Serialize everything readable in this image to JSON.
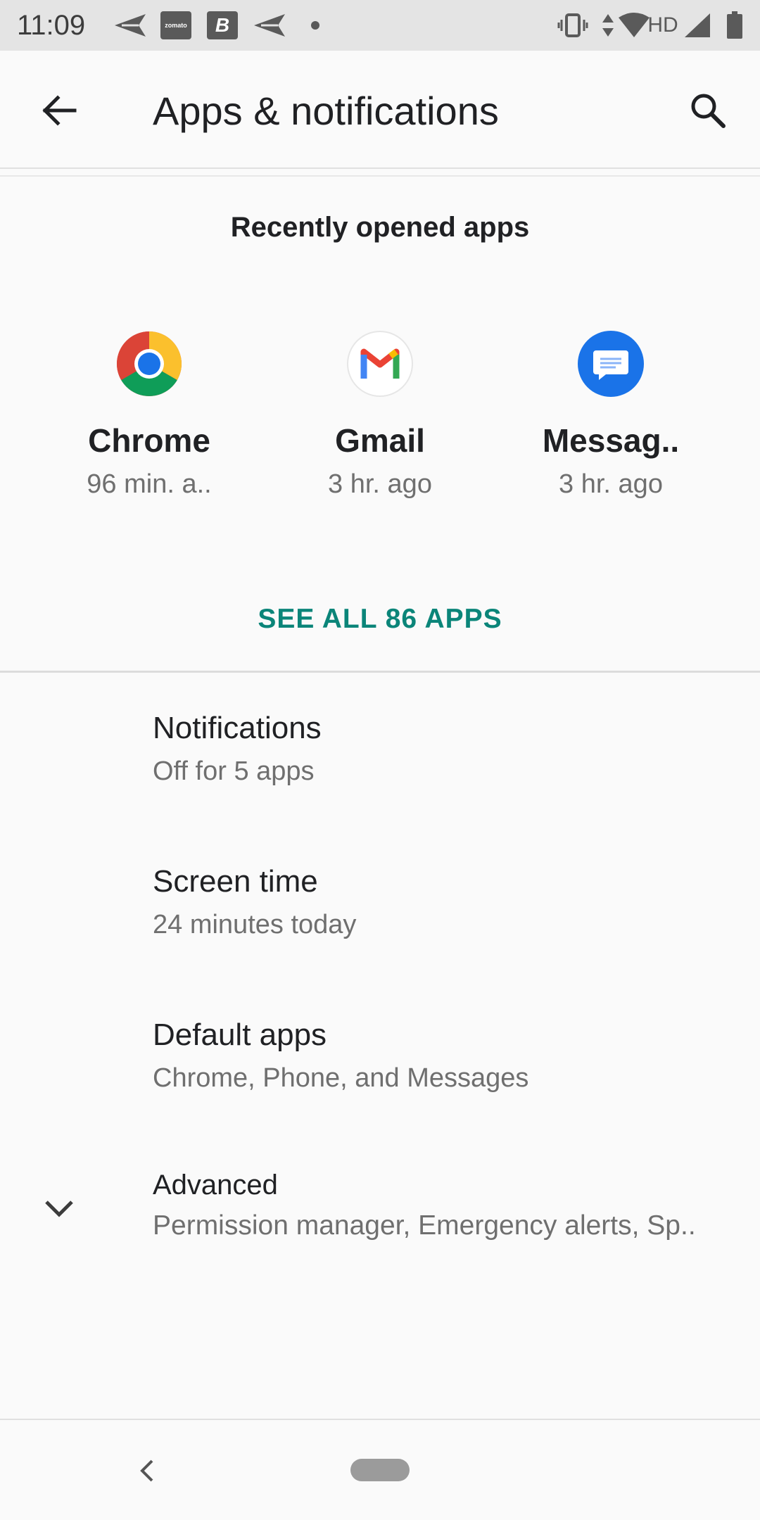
{
  "status_bar": {
    "time": "11:09",
    "zomato_label": "zomato",
    "b_label": "B",
    "network_label": "HD",
    "icons": [
      "send-icon",
      "zomato-icon",
      "b-app-icon",
      "send-icon",
      "dot-icon",
      "vibrate-icon",
      "data-arrows-icon",
      "wifi-icon",
      "signal-icon",
      "battery-icon"
    ]
  },
  "toolbar": {
    "title": "Apps & notifications",
    "back_icon": "arrow-back-icon",
    "search_icon": "search-icon"
  },
  "recent": {
    "title": "Recently opened apps",
    "apps": [
      {
        "name": "Chrome",
        "time": "96 min. a..",
        "icon": "chrome-icon"
      },
      {
        "name": "Gmail",
        "time": "3 hr. ago",
        "icon": "gmail-icon"
      },
      {
        "name": "Messag..",
        "time": "3 hr. ago",
        "icon": "messages-icon"
      }
    ],
    "see_all": "SEE ALL 86 APPS"
  },
  "list": {
    "items": [
      {
        "title": "Notifications",
        "subtitle": "Off for 5 apps"
      },
      {
        "title": "Screen time",
        "subtitle": "24 minutes today"
      },
      {
        "title": "Default apps",
        "subtitle": "Chrome, Phone, and Messages"
      },
      {
        "title": "Advanced",
        "subtitle": "Permission manager, Emergency alerts, Sp..",
        "icon": "chevron-down-icon"
      }
    ]
  },
  "nav_bar": {
    "back_icon": "nav-back-icon",
    "home_icon": "nav-home-pill"
  },
  "colors": {
    "accent": "#0b8579",
    "status_bar_bg": "#e4e4e4",
    "background": "#fafafa",
    "messages_blue": "#1a73e8"
  }
}
